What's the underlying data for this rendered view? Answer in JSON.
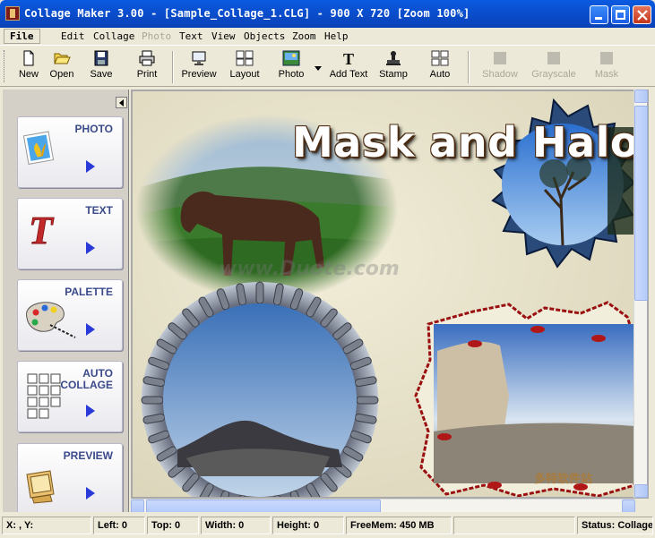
{
  "window": {
    "title": "Collage Maker 3.00  - [Sample_Collage_1.CLG] - 900 X 720  [Zoom 100%]",
    "controls": [
      "minimize",
      "maximize",
      "close"
    ]
  },
  "menu": [
    {
      "label": "File",
      "state": "active"
    },
    {
      "label": "Edit",
      "state": "normal"
    },
    {
      "label": "Collage",
      "state": "normal"
    },
    {
      "label": "Photo",
      "state": "disabled"
    },
    {
      "label": "Text",
      "state": "normal"
    },
    {
      "label": "View",
      "state": "normal"
    },
    {
      "label": "Objects",
      "state": "normal"
    },
    {
      "label": "Zoom",
      "state": "normal"
    },
    {
      "label": "Help",
      "state": "normal"
    }
  ],
  "toolbar": [
    {
      "label": "New",
      "icon": "new-document-icon",
      "enabled": true
    },
    {
      "label": "Open",
      "icon": "open-folder-icon",
      "enabled": true
    },
    {
      "label": "Save",
      "icon": "floppy-disk-icon",
      "enabled": true
    },
    {
      "label": "Print",
      "icon": "printer-icon",
      "enabled": true
    },
    {
      "label": "Preview",
      "icon": "monitor-icon",
      "enabled": true
    },
    {
      "label": "Layout",
      "icon": "layout-grid-icon",
      "enabled": true
    },
    {
      "label": "Photo",
      "icon": "photo-icon",
      "enabled": true,
      "has_dropdown": true
    },
    {
      "label": "Add Text",
      "icon": "text-t-icon",
      "enabled": true
    },
    {
      "label": "Stamp",
      "icon": "stamp-icon",
      "enabled": true
    },
    {
      "label": "Auto",
      "icon": "auto-grid-icon",
      "enabled": true
    },
    {
      "label": "Shadow",
      "icon": "shadow-icon",
      "enabled": false
    },
    {
      "label": "Grayscale",
      "icon": "grayscale-icon",
      "enabled": false
    },
    {
      "label": "Mask",
      "icon": "mask-icon",
      "enabled": false
    }
  ],
  "side_panel": {
    "buttons": [
      {
        "label": "PHOTO",
        "icon": "photo-panel-icon"
      },
      {
        "label": "TEXT",
        "icon": "text-panel-icon"
      },
      {
        "label": "PALETTE",
        "icon": "palette-icon"
      },
      {
        "label": "AUTO COLLAGE",
        "label_lines": [
          "AUTO",
          "COLLAGE"
        ],
        "icon": "auto-collage-icon"
      },
      {
        "label": "PREVIEW",
        "icon": "preview-monitor-icon"
      }
    ]
  },
  "canvas": {
    "collage_title": "Mask and Halo",
    "watermark": "www.Duote.com",
    "corner_logo": "多特软件站",
    "photos": [
      "horse-photo",
      "tree-photo",
      "mountain-photo",
      "rock-photo"
    ]
  },
  "status": {
    "coords": "X: , Y:",
    "left": "Left: 0",
    "top": "Top: 0",
    "width": "Width: 0",
    "height": "Height: 0",
    "freemem": "FreeMem: 450 MB",
    "empty": "",
    "status": "Status: Collage"
  },
  "colors": {
    "titlebar": "#0a4fd0",
    "chrome": "#ece9d8",
    "panel": "#d4d0c8",
    "panel_label": "#3a4a8a",
    "arrow": "#2a3ad8"
  }
}
